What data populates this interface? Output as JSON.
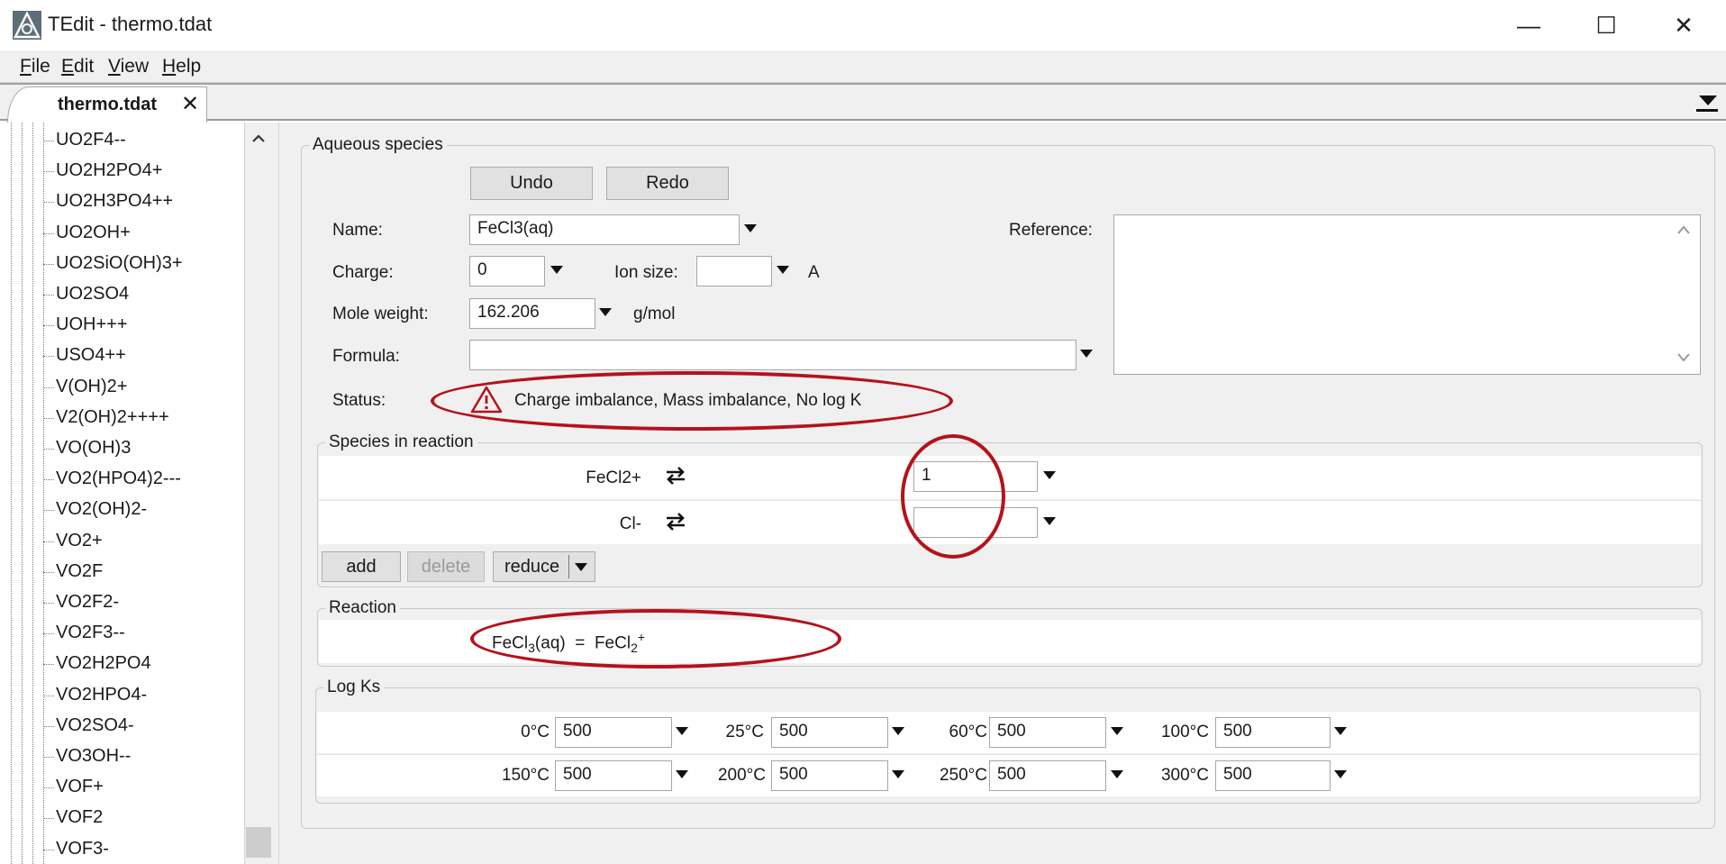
{
  "window": {
    "title": "TEdit - thermo.tdat",
    "minimize": "—",
    "maximize": "☐",
    "close": "✕"
  },
  "menu": {
    "file": {
      "mnemonic": "F",
      "rest": "ile"
    },
    "edit": {
      "mnemonic": "E",
      "rest": "dit"
    },
    "view": {
      "mnemonic": "V",
      "rest": "iew"
    },
    "help": {
      "mnemonic": "H",
      "rest": "elp"
    }
  },
  "tab": {
    "label": "thermo.tdat",
    "close": "✕"
  },
  "tree": {
    "items": [
      "UO2F4--",
      "UO2H2PO4+",
      "UO2H3PO4++",
      "UO2OH+",
      "UO2SiO(OH)3+",
      "UO2SO4",
      "UOH+++",
      "USO4++",
      "V(OH)2+",
      "V2(OH)2++++",
      "VO(OH)3",
      "VO2(HPO4)2---",
      "VO2(OH)2-",
      "VO2+",
      "VO2F",
      "VO2F2-",
      "VO2F3--",
      "VO2H2PO4",
      "VO2HPO4-",
      "VO2SO4-",
      "VO3OH--",
      "VOF+",
      "VOF2",
      "VOF3-"
    ]
  },
  "aqueous": {
    "group_label": "Aqueous species",
    "undo": "Undo",
    "redo": "Redo",
    "name_label": "Name:",
    "name_value": "FeCl3(aq)",
    "reference_label": "Reference:",
    "reference_value": "",
    "charge_label": "Charge:",
    "charge_value": "0",
    "ion_size_label": "Ion size:",
    "ion_size_value": "",
    "ion_size_unit": "A",
    "mole_weight_label": "Mole weight:",
    "mole_weight_value": "162.206",
    "mole_weight_unit": "g/mol",
    "formula_label": "Formula:",
    "formula_value": "",
    "status_label": "Status:",
    "status_text": "Charge imbalance, Mass imbalance, No log K"
  },
  "species": {
    "group_label": "Species in reaction",
    "rows": [
      {
        "name": "FeCl2+",
        "coef": "1"
      },
      {
        "name": "Cl-",
        "coef": ""
      }
    ],
    "add": "add",
    "delete": "delete",
    "reduce": "reduce"
  },
  "reaction": {
    "group_label": "Reaction",
    "lhs_base": "FeCl",
    "lhs_sub": "3",
    "lhs_tail": "(aq)",
    "equals": "=",
    "rhs_base": "FeCl",
    "rhs_sub": "2",
    "rhs_sup": "+"
  },
  "logks": {
    "group_label": "Log Ks",
    "temps": [
      {
        "label": "0°C",
        "value": "500"
      },
      {
        "label": "25°C",
        "value": "500"
      },
      {
        "label": "60°C",
        "value": "500"
      },
      {
        "label": "100°C",
        "value": "500"
      },
      {
        "label": "150°C",
        "value": "500"
      },
      {
        "label": "200°C",
        "value": "500"
      },
      {
        "label": "250°C",
        "value": "500"
      },
      {
        "label": "300°C",
        "value": "500"
      }
    ]
  },
  "colors": {
    "annotation": "#b5121b",
    "warning": "#b5121b",
    "panel": "#f0f0f0"
  }
}
